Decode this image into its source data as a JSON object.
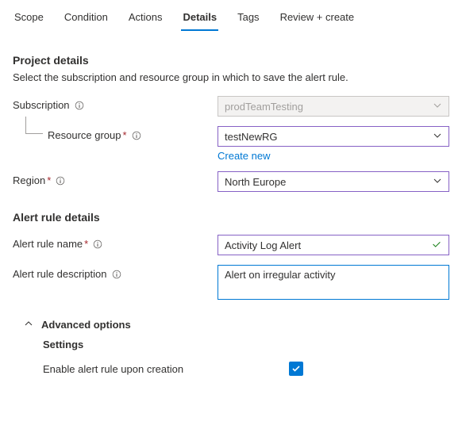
{
  "tabs": {
    "scope": "Scope",
    "condition": "Condition",
    "actions": "Actions",
    "details": "Details",
    "tags": "Tags",
    "review": "Review + create"
  },
  "project": {
    "heading": "Project details",
    "desc": "Select the subscription and resource group in which to save the alert rule.",
    "subscription_label": "Subscription",
    "subscription_value": "prodTeamTesting",
    "resource_group_label": "Resource group",
    "resource_group_value": "testNewRG",
    "create_new": "Create new",
    "region_label": "Region",
    "region_value": "North Europe"
  },
  "alert": {
    "heading": "Alert rule details",
    "name_label": "Alert rule name",
    "name_value": "Activity Log Alert",
    "desc_label": "Alert rule description",
    "desc_value": "Alert on irregular activity"
  },
  "advanced": {
    "toggle": "Advanced options",
    "settings": "Settings",
    "enable_label": "Enable alert rule upon creation"
  }
}
